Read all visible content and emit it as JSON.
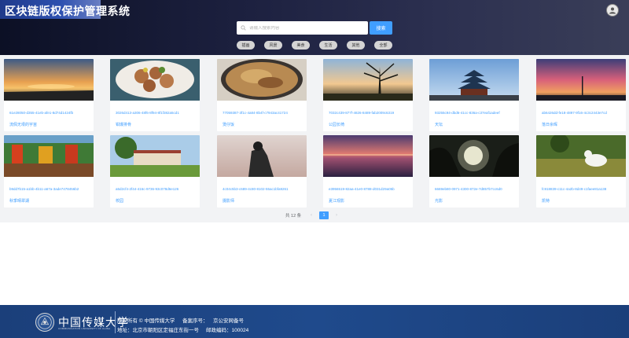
{
  "header": {
    "app_title": "区块链版权保护管理系统",
    "search_placeholder": "请输入搜索内容",
    "search_button": "搜索",
    "categories": [
      "插画",
      "风景",
      "美食",
      "生活",
      "其他",
      "全部"
    ]
  },
  "gallery": {
    "cards": [
      {
        "uuid": "61e28050-d355-41eb-afe1-8d74d1424fb",
        "title": "流佩无垠的宇宙"
      },
      {
        "uuid": "3026d413-a306-48f6-8f94-8f1f382a5cd1",
        "title": "钳爆排骨"
      },
      {
        "uuid": "77059387-3f1c-4a84-8b4f-c7943ac41724",
        "title": "煲仔饭"
      },
      {
        "uuid": "7032c439-877f-4826-8489-fab2009c6319",
        "title": "公园长椅"
      },
      {
        "uuid": "93255c94-dbd6-41cc-836a-c37eaf1adeef",
        "title": "天坛"
      },
      {
        "uuid": "ab6426dd-fe18-4897-9f16-4c3c2443e7cd",
        "title": "落日余晖"
      },
      {
        "uuid": "b9dd7b15-a1bb-4b11-a67a-3ade7478456b2",
        "title": "秋季晴翠湖"
      },
      {
        "uuid": "a5d2cf4-2f44-416c-9736-93c078d6e126",
        "title": "校园"
      },
      {
        "uuid": "4c04c5b3-c689-4c80-8102-55ac1bfa9261",
        "title": "摄影师"
      },
      {
        "uuid": "e3956519-82aa-41e0-8788-d031d29a05b",
        "title": "夏江观影"
      },
      {
        "uuid": "6669eb80-0971-4300-872e-7d857b7cc6d0",
        "title": "光影"
      },
      {
        "uuid": "fc918839-c11c-4a2b-8d49-c1faee81a138",
        "title": "凯特"
      }
    ]
  },
  "pagination": {
    "total": "共 12 条",
    "prev": "‹",
    "current": "1",
    "next": "›"
  },
  "footer": {
    "school_name": "中国传媒大学",
    "school_name_en": "COMMUNICATION UNIVERSITY OF CHINA",
    "copyright": "版权所有 © 中国传媒大学",
    "record_label": "备案序号：",
    "record_value": "京公安网备号",
    "address": "地址：北京市朝阳区定福庄东街一号",
    "postcode": "邮政编码：100024"
  },
  "colors": {
    "accent": "#409eff",
    "header_bg": "#1d2140",
    "footer_bg": "#1f4a8c"
  },
  "icons": [
    "search-icon",
    "user-avatar-icon",
    "school-emblem-icon"
  ]
}
